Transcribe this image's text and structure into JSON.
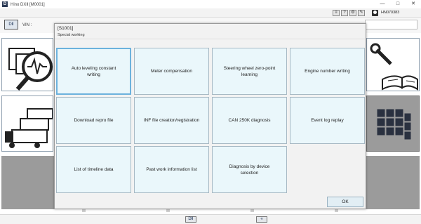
{
  "window": {
    "logo_text": "D",
    "title": "Hino DXⅡ [M0001]",
    "minimize": "—",
    "maximize": "□",
    "close": "✕"
  },
  "toolbar": {
    "user_id": "HN070383",
    "icons": [
      "list-icon",
      "help-icon",
      "settings-gear-icon",
      "report-icon",
      "user-avatar-icon"
    ]
  },
  "vin_row": {
    "logo_text": "DⅡ",
    "vin_label": "VIN :"
  },
  "dialog": {
    "code": "[S1001]",
    "subtitle": "Special working",
    "functions": [
      "Auto leveling constant writing",
      "Meter compensation",
      "Steering wheel zero-point learning",
      "Engine number writing",
      "Download repro file",
      "INF file creation/registration",
      "CAN 250K diagnosis",
      "Event log replay",
      "List of timeline data",
      "Past work information list",
      "Diagnosis by device selection"
    ],
    "selected_function": "Auto leveling constant writing",
    "ok_label": "OK"
  },
  "statusbar": {
    "home_label": "DⅡ",
    "back_label": "«"
  },
  "colors": {
    "function_button_bg": "#eaf7fb",
    "selected_border": "#6cb2dd",
    "brand_navy": "#1d3357",
    "background_tile_gray": "#9b9b9b"
  }
}
